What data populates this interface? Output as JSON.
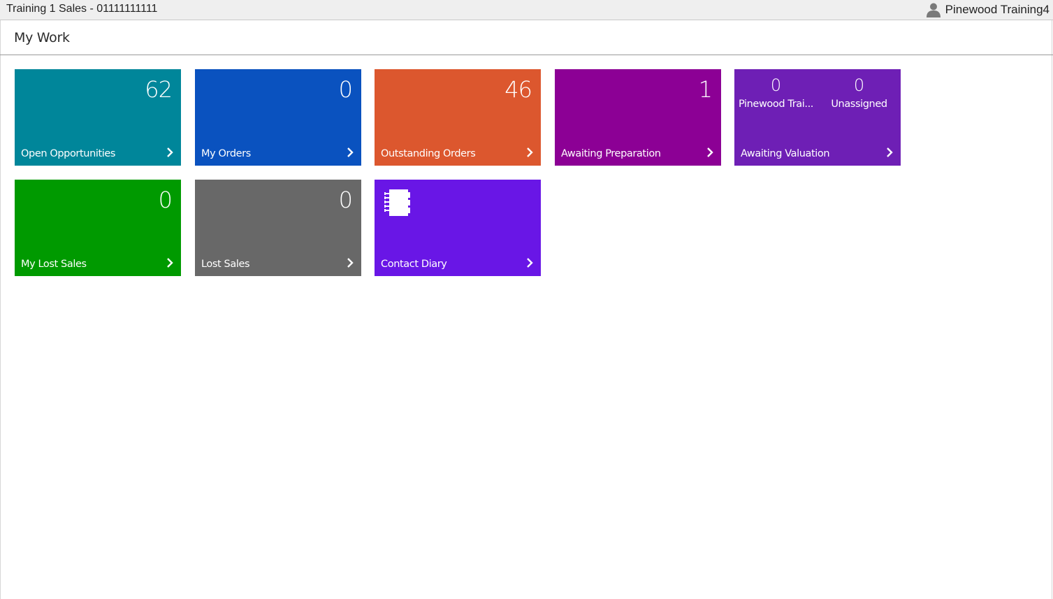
{
  "window": {
    "title": "Training 1 Sales - 01111111111",
    "user_name": "Pinewood Training4",
    "user_icon": "user-icon"
  },
  "page": {
    "title": "My Work"
  },
  "tiles": {
    "open_opportunities": {
      "label": "Open Opportunities",
      "count": "62",
      "color": "#00869a"
    },
    "my_orders": {
      "label": "My Orders",
      "count": "0",
      "color": "#0a52bf"
    },
    "outstanding_orders": {
      "label": "Outstanding Orders",
      "count": "46",
      "color": "#dc572e"
    },
    "awaiting_preparation": {
      "label": "Awaiting Preparation",
      "count": "1",
      "color": "#8c0095"
    },
    "awaiting_valuation": {
      "label": "Awaiting Valuation",
      "color": "#6e1fb5",
      "left": {
        "count": "0",
        "label": "Pinewood Trai..."
      },
      "right": {
        "count": "0",
        "label": "Unassigned"
      }
    },
    "my_lost_sales": {
      "label": "My Lost Sales",
      "count": "0",
      "color": "#009a00"
    },
    "lost_sales": {
      "label": "Lost Sales",
      "count": "0",
      "color": "#686868"
    },
    "contact_diary": {
      "label": "Contact Diary",
      "color": "#6916e6",
      "icon": "notebook-icon"
    }
  },
  "icons": {
    "chevron": "chevron-right-icon"
  }
}
